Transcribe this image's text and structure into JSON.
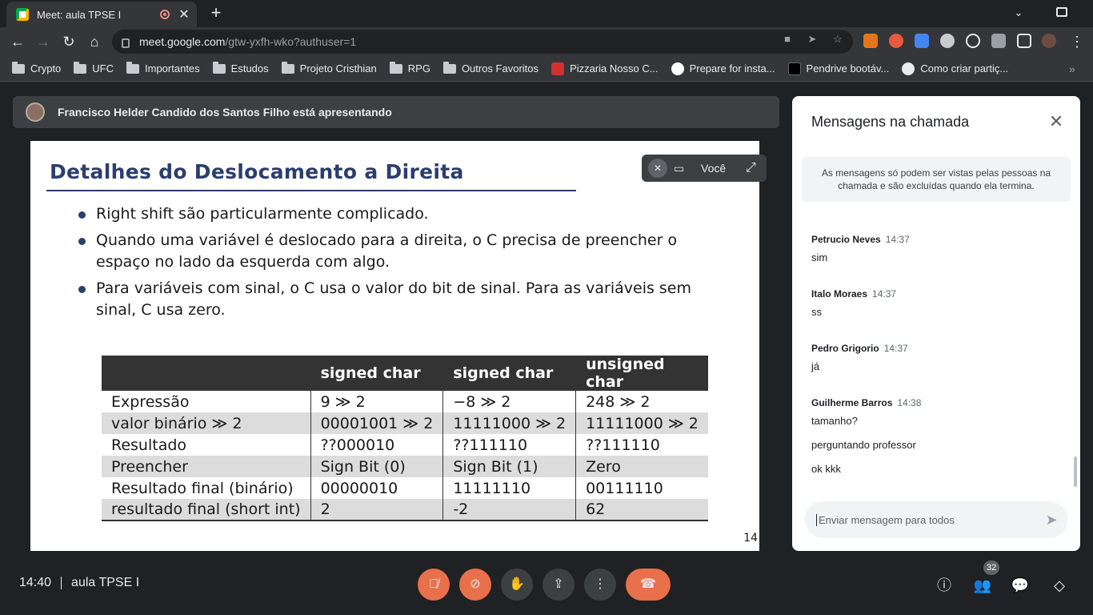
{
  "tab": {
    "title": "Meet: aula TPSE I",
    "close": "✕",
    "new_tab": "+"
  },
  "toolbar": {
    "url_host": "meet.google.com",
    "url_path": "/gtw-yxfh-wko?authuser=1"
  },
  "bookmarks": [
    {
      "label": "Crypto",
      "type": "folder"
    },
    {
      "label": "UFC",
      "type": "folder"
    },
    {
      "label": "Importantes",
      "type": "folder"
    },
    {
      "label": "Estudos",
      "type": "folder"
    },
    {
      "label": "Projeto Cristhian",
      "type": "folder"
    },
    {
      "label": "RPG",
      "type": "folder"
    },
    {
      "label": "Outros Favoritos",
      "type": "folder"
    },
    {
      "label": "Pizzaria Nosso C...",
      "type": "site",
      "color": "#d32f2f"
    },
    {
      "label": "Prepare for insta...",
      "type": "site",
      "color": "#ffffff"
    },
    {
      "label": "Pendrive bootáv...",
      "type": "site",
      "color": "#000000"
    },
    {
      "label": "Como criar partiç...",
      "type": "site",
      "color": "#e8eaed"
    }
  ],
  "meet": {
    "presenter_text": "Francisco Helder Candido dos Santos Filho está apresentando",
    "self_name": "Você",
    "meeting_time": "14:40",
    "meeting_name": "aula TPSE I",
    "participants_count": "32"
  },
  "slide": {
    "title": "Detalhes do Deslocamento a Direita",
    "bullets": [
      "Right shift são particularmente complicado.",
      "Quando uma variável é deslocado para a direita, o C precisa de preencher o espaço no lado da esquerda com algo.",
      "Para variáveis com sinal, o C usa o valor do bit de sinal. Para as variáveis sem sinal, C usa zero."
    ],
    "table": {
      "headers": [
        "",
        "signed char",
        "signed char",
        "unsigned char"
      ],
      "rows": [
        [
          "Expressão",
          "9 ≫ 2",
          "−8 ≫ 2",
          "248 ≫ 2"
        ],
        [
          "valor binário ≫ 2",
          "00001001 ≫ 2",
          "11111000 ≫ 2",
          "11111000 ≫ 2"
        ],
        [
          "Resultado",
          "??000010",
          "??111110",
          "??111110"
        ],
        [
          "Preencher",
          "Sign Bit (0)",
          "Sign Bit (1)",
          "Zero"
        ],
        [
          "Resultado final (binário)",
          "00000010",
          "11111110",
          "00111110"
        ],
        [
          "resultado final (short int)",
          "2",
          "-2",
          "62"
        ]
      ]
    },
    "page_number": "14"
  },
  "chat": {
    "title": "Mensagens na chamada",
    "notice": "As mensagens só podem ser vistas pelas pessoas na chamada e são excluídas quando ela termina.",
    "messages": [
      {
        "sender": "Petrucio Neves",
        "time": "14:37",
        "texts": [
          "sim"
        ]
      },
      {
        "sender": "Italo Moraes",
        "time": "14:37",
        "texts": [
          "ss"
        ]
      },
      {
        "sender": "Pedro Grigorio",
        "time": "14:37",
        "texts": [
          "já"
        ]
      },
      {
        "sender": "Guilherme Barros",
        "time": "14:38",
        "texts": [
          "tamanho?",
          "perguntando professor",
          "ok kkk"
        ]
      }
    ],
    "input_placeholder": "Enviar mensagem para todos"
  },
  "colors": {
    "slide_title": "#2c3e6b",
    "control_red": "#e8704a",
    "meet_bg": "#202124",
    "chat_active": "#8ab4f8"
  }
}
